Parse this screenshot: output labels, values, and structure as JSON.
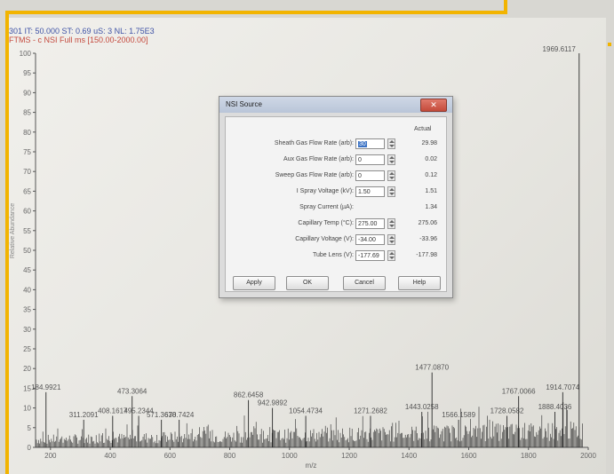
{
  "status_line": "301  IT: 50.000  ST: 0.69  uS: 3  NL: 1.75E3",
  "scan_filter": "FTMS - c NSI Full ms [150.00-2000.00]",
  "colors": {
    "frame_accent": "#f2b400",
    "status_blue": "#3f53a6",
    "filter_red": "#c44a3e",
    "spectrum": "#2a2a2a"
  },
  "dialog": {
    "title": "NSI Source",
    "close_icon": "close-icon",
    "actual_header": "Actual",
    "rows": [
      {
        "label": "Sheath Gas Flow Rate (arb):",
        "value": "30",
        "actual": "29.98",
        "selected": true
      },
      {
        "label": "Aux Gas Flow Rate (arb):",
        "value": "0",
        "actual": "0.02"
      },
      {
        "label": "Sweep Gas Flow Rate (arb):",
        "value": "0",
        "actual": "0.12"
      },
      {
        "label": "I Spray Voltage (kV):",
        "value": "1.50",
        "actual": "1.51"
      },
      {
        "label": "Spray Current (µA):",
        "value": "",
        "actual": "1.34",
        "no_input": true
      },
      {
        "label": "Capillary Temp (°C):",
        "value": "275.00",
        "actual": "275.06"
      },
      {
        "label": "Capillary Voltage (V):",
        "value": "-34.00",
        "actual": "-33.96"
      },
      {
        "label": "Tube Lens (V):",
        "value": "-177.69",
        "actual": "-177.98"
      }
    ],
    "buttons": {
      "apply": "Apply",
      "ok": "OK",
      "cancel": "Cancel",
      "help": "Help"
    }
  },
  "chart_data": {
    "type": "line",
    "xlabel": "m/z",
    "ylabel": "Relative Abundance",
    "xlim": [
      150,
      2000
    ],
    "ylim": [
      0,
      100
    ],
    "xticks": [
      200,
      400,
      600,
      800,
      1000,
      1200,
      1400,
      1600,
      1800,
      2000
    ],
    "yticks": [
      0,
      5,
      10,
      15,
      20,
      25,
      30,
      35,
      40,
      45,
      50,
      55,
      60,
      65,
      70,
      75,
      80,
      85,
      90,
      95,
      100
    ],
    "peaks": [
      {
        "x": 184.9921,
        "y": 14,
        "label": "184.9921"
      },
      {
        "x": 311.2091,
        "y": 7,
        "label": "311.2091"
      },
      {
        "x": 408.1617,
        "y": 8,
        "label": "408.1617"
      },
      {
        "x": 473.3064,
        "y": 13,
        "label": "473.3064"
      },
      {
        "x": 495.2344,
        "y": 8,
        "label": "495.2344"
      },
      {
        "x": 571.3678,
        "y": 7,
        "label": "571.3678"
      },
      {
        "x": 630.7424,
        "y": 7,
        "label": "630.7424"
      },
      {
        "x": 862.6458,
        "y": 12,
        "label": "862.6458"
      },
      {
        "x": 942.9892,
        "y": 10,
        "label": "942.9892"
      },
      {
        "x": 1054.4734,
        "y": 8,
        "label": "1054.4734"
      },
      {
        "x": 1271.2682,
        "y": 8,
        "label": "1271.2682"
      },
      {
        "x": 1443.0258,
        "y": 9,
        "label": "1443.0258"
      },
      {
        "x": 1477.087,
        "y": 19,
        "label": "1477.0870"
      },
      {
        "x": 1566.1589,
        "y": 7,
        "label": "1566.1589"
      },
      {
        "x": 1728.0582,
        "y": 8,
        "label": "1728.0582"
      },
      {
        "x": 1767.0066,
        "y": 13,
        "label": "1767.0066"
      },
      {
        "x": 1888.4036,
        "y": 9,
        "label": "1888.4036"
      },
      {
        "x": 1914.7074,
        "y": 14,
        "label": "1914.7074"
      },
      {
        "x": 1969.6117,
        "y": 100,
        "label": "1969.6117"
      }
    ]
  }
}
